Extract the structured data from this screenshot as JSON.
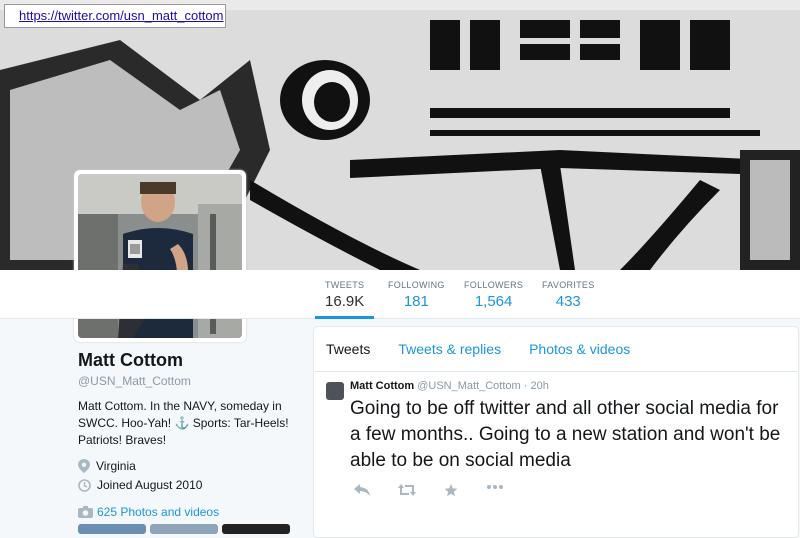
{
  "browser": {
    "url": "https://twitter.com/usn_matt_cottom"
  },
  "stats": [
    {
      "label": "TWEETS",
      "value": "16.9K"
    },
    {
      "label": "FOLLOWING",
      "value": "181"
    },
    {
      "label": "FOLLOWERS",
      "value": "1,564"
    },
    {
      "label": "FAVORITES",
      "value": "433"
    }
  ],
  "profile": {
    "name": "Matt Cottom",
    "handle": "@USN_Matt_Cottom",
    "bio": "Matt Cottom. In the NAVY, someday in SWCC. Hoo-Yah! ⚓ Sports: Tar-Heels! Patriots! Braves!",
    "location": "Virginia",
    "joined": "Joined August 2010",
    "photos_link": "625 Photos and videos"
  },
  "tabs": [
    "Tweets",
    "Tweets & replies",
    "Photos & videos"
  ],
  "tweet": {
    "name": "Matt Cottom",
    "handle": "@USN_Matt_Cottom",
    "time": "· 20h",
    "text": "Going to be off twitter and all other social media for a few months.. Going to a new station and won't be able to be on social media"
  },
  "colors": {
    "accent": "#1b95e0"
  },
  "icons": [
    "location-pin-icon",
    "clock-icon",
    "camera-icon",
    "reply-icon",
    "retweet-icon",
    "favorite-star-icon",
    "more-dots-icon"
  ]
}
